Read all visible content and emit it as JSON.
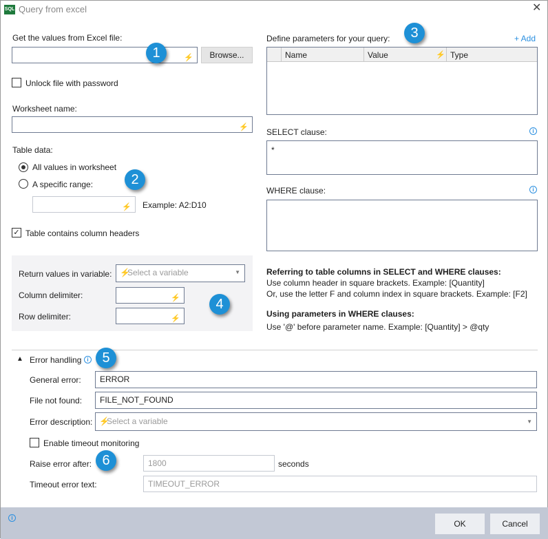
{
  "window": {
    "title": "Query from excel",
    "icon_text": "SQL"
  },
  "left": {
    "excel_file_label": "Get the values from Excel file:",
    "excel_file_value": "",
    "browse_label": "Browse...",
    "unlock_label": "Unlock file with password",
    "unlock_checked": false,
    "worksheet_label": "Worksheet name:",
    "worksheet_value": "",
    "table_data_label": "Table data:",
    "radio_all": "All values in worksheet",
    "radio_range": "A specific range:",
    "selected_radio": "All values in worksheet",
    "range_value": "",
    "range_example": "Example: A2:D10",
    "headers_label": "Table contains column headers",
    "headers_checked": true,
    "return_label": "Return values in variable:",
    "return_placeholder": "Select a variable",
    "col_delim_label": "Column delimiter:",
    "row_delim_label": "Row delimiter:"
  },
  "right": {
    "params_label": "Define parameters for your query:",
    "add_label": "+ Add",
    "columns": [
      "Name",
      "Value",
      "Type"
    ],
    "select_label": "SELECT clause:",
    "select_value": "*",
    "where_label": "WHERE clause:",
    "where_value": "",
    "help": {
      "h1": "Referring to table columns in SELECT and WHERE clauses:",
      "l1": "Use column header in square brackets. Example: [Quantity]",
      "l2": "Or, use the letter F and column index in square brackets. Example: [F2]",
      "h2": "Using parameters in WHERE clauses:",
      "l3": "Use '@' before parameter name. Example: [Quantity] > @qty"
    }
  },
  "error": {
    "title": "Error handling",
    "general_label": "General error:",
    "general_value": "ERROR",
    "notfound_label": "File not found:",
    "notfound_value": "FILE_NOT_FOUND",
    "desc_label": "Error description:",
    "desc_placeholder": "Select a variable",
    "timeout_label": "Enable timeout monitoring",
    "timeout_checked": false,
    "raise_label": "Raise error after:",
    "raise_value": "1800",
    "seconds": "seconds",
    "timeout_text_label": "Timeout error text:",
    "timeout_text_value": "TIMEOUT_ERROR"
  },
  "badges": [
    "1",
    "2",
    "3",
    "4",
    "5",
    "6"
  ],
  "footer": {
    "ok": "OK",
    "cancel": "Cancel"
  },
  "colors": {
    "accent": "#1e90d6",
    "footer_bg": "#c2c8d5",
    "link": "#2a8fe0"
  }
}
